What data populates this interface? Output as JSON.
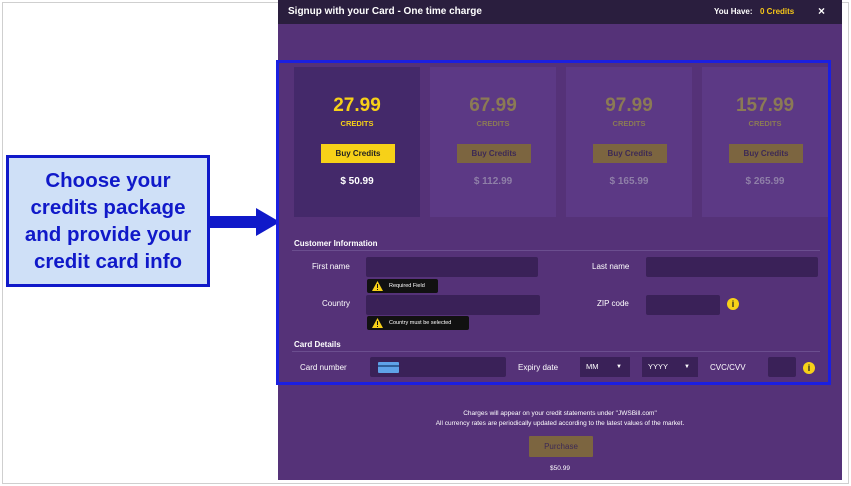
{
  "callout": {
    "text": "Choose your\ncredits package\nand provide your\ncredit card info"
  },
  "modal": {
    "title": "Signup with your Card - One time charge",
    "you_have_label": "You Have:",
    "credits_balance": "0 Credits",
    "close": "×"
  },
  "packages": [
    {
      "amount": "27.99",
      "unit": "CREDITS",
      "button": "Buy Credits",
      "price": "$ 50.99",
      "selected": true
    },
    {
      "amount": "67.99",
      "unit": "CREDITS",
      "button": "Buy Credits",
      "price": "$ 112.99",
      "selected": false
    },
    {
      "amount": "97.99",
      "unit": "CREDITS",
      "button": "Buy Credits",
      "price": "$ 165.99",
      "selected": false
    },
    {
      "amount": "157.99",
      "unit": "CREDITS",
      "button": "Buy Credits",
      "price": "$ 265.99",
      "selected": false
    }
  ],
  "customer": {
    "heading": "Customer Information",
    "first_name_label": "First name",
    "last_name_label": "Last name",
    "country_label": "Country",
    "zip_label": "ZIP code",
    "first_name_error": "Required Field",
    "country_error": "Country must be selected",
    "info": "i"
  },
  "card": {
    "heading": "Card Details",
    "number_label": "Card number",
    "expiry_label": "Expiry date",
    "month": "MM",
    "year": "YYYY",
    "cvc_label": "CVC/CVV",
    "info": "i"
  },
  "footer": {
    "line1": "Charges will appear on your credit statements under \"JWSBill.com\"",
    "line2": "All currency rates are periodically updated according to the latest values of the market.",
    "purchase": "Purchase",
    "total": "$50.99"
  },
  "colors": {
    "accent": "#f7d118",
    "modal_bg": "#553278",
    "highlight": "#1b1fe0"
  }
}
